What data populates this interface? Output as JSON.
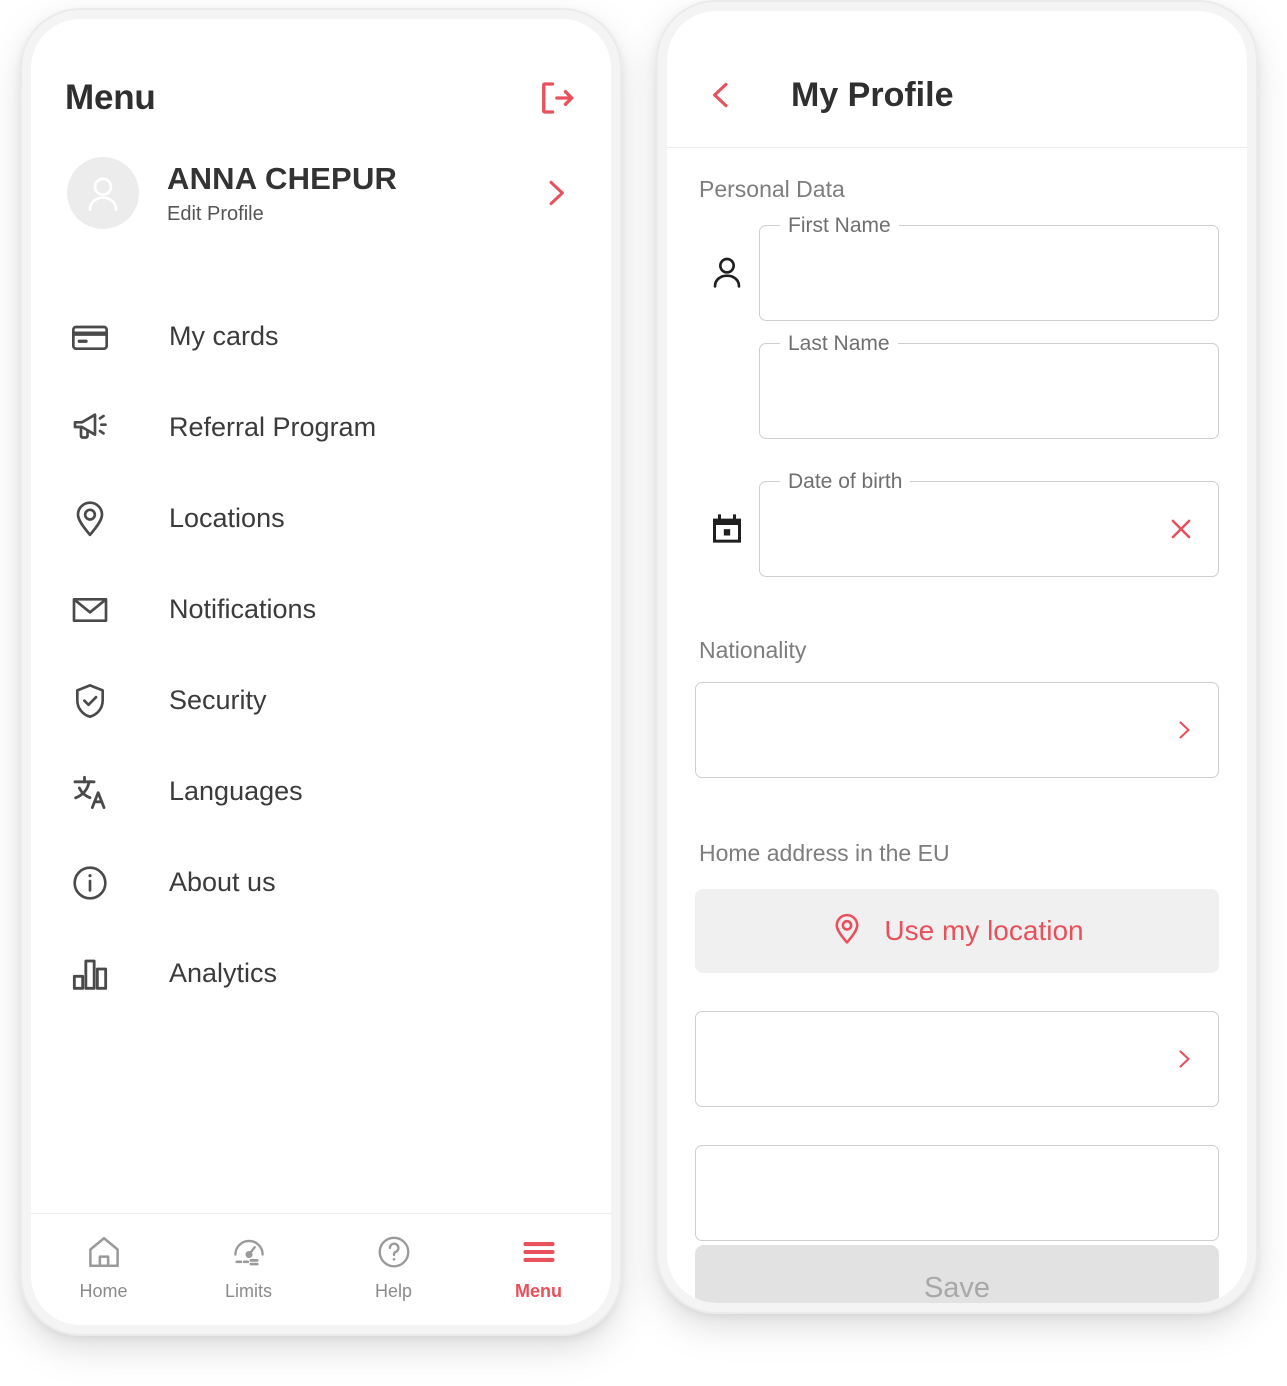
{
  "colors": {
    "accent": "#e8505b",
    "text_primary": "#333333",
    "text_secondary": "#7d7d7d",
    "border": "#cfcfcf",
    "disabled_bg": "#e2e2e2",
    "disabled_text": "#a8a8a8"
  },
  "menu_screen": {
    "title": "Menu",
    "logout_icon": "logout-icon",
    "profile": {
      "name": "ANNA CHEPUR",
      "subtitle": "Edit Profile",
      "avatar_icon": "person-avatar-icon",
      "chevron_icon": "chevron-right-icon"
    },
    "items": [
      {
        "label": "My cards",
        "icon": "credit-card-icon"
      },
      {
        "label": "Referral Program",
        "icon": "megaphone-icon"
      },
      {
        "label": "Locations",
        "icon": "map-pin-icon"
      },
      {
        "label": "Notifications",
        "icon": "envelope-icon"
      },
      {
        "label": "Security",
        "icon": "shield-check-icon"
      },
      {
        "label": "Languages",
        "icon": "translate-icon"
      },
      {
        "label": "About us",
        "icon": "info-circle-icon"
      },
      {
        "label": "Analytics",
        "icon": "bar-chart-icon"
      }
    ],
    "tabbar": [
      {
        "label": "Home",
        "icon": "home-icon",
        "active": false
      },
      {
        "label": "Limits",
        "icon": "gauge-icon",
        "active": false
      },
      {
        "label": "Help",
        "icon": "question-icon",
        "active": false
      },
      {
        "label": "Menu",
        "icon": "hamburger-icon",
        "active": true
      }
    ]
  },
  "profile_screen": {
    "title": "My Profile",
    "back_icon": "chevron-left-icon",
    "section_personal": "Personal Data",
    "fields": {
      "first_name": {
        "label": "First Name",
        "value": "",
        "icon": "person-icon"
      },
      "last_name": {
        "label": "Last Name",
        "value": ""
      },
      "date_of_birth": {
        "label": "Date of birth",
        "value": "",
        "icon": "calendar-icon",
        "clear_icon": "close-x-icon"
      }
    },
    "section_nationality": "Nationality",
    "nationality": {
      "value": "",
      "chevron_icon": "chevron-right-icon"
    },
    "section_address": "Home address in the EU",
    "use_location": {
      "label": "Use my location",
      "icon": "map-pin-icon"
    },
    "address_field": {
      "value": "",
      "chevron_icon": "chevron-right-icon"
    },
    "save": {
      "label": "Save",
      "disabled": true
    }
  }
}
